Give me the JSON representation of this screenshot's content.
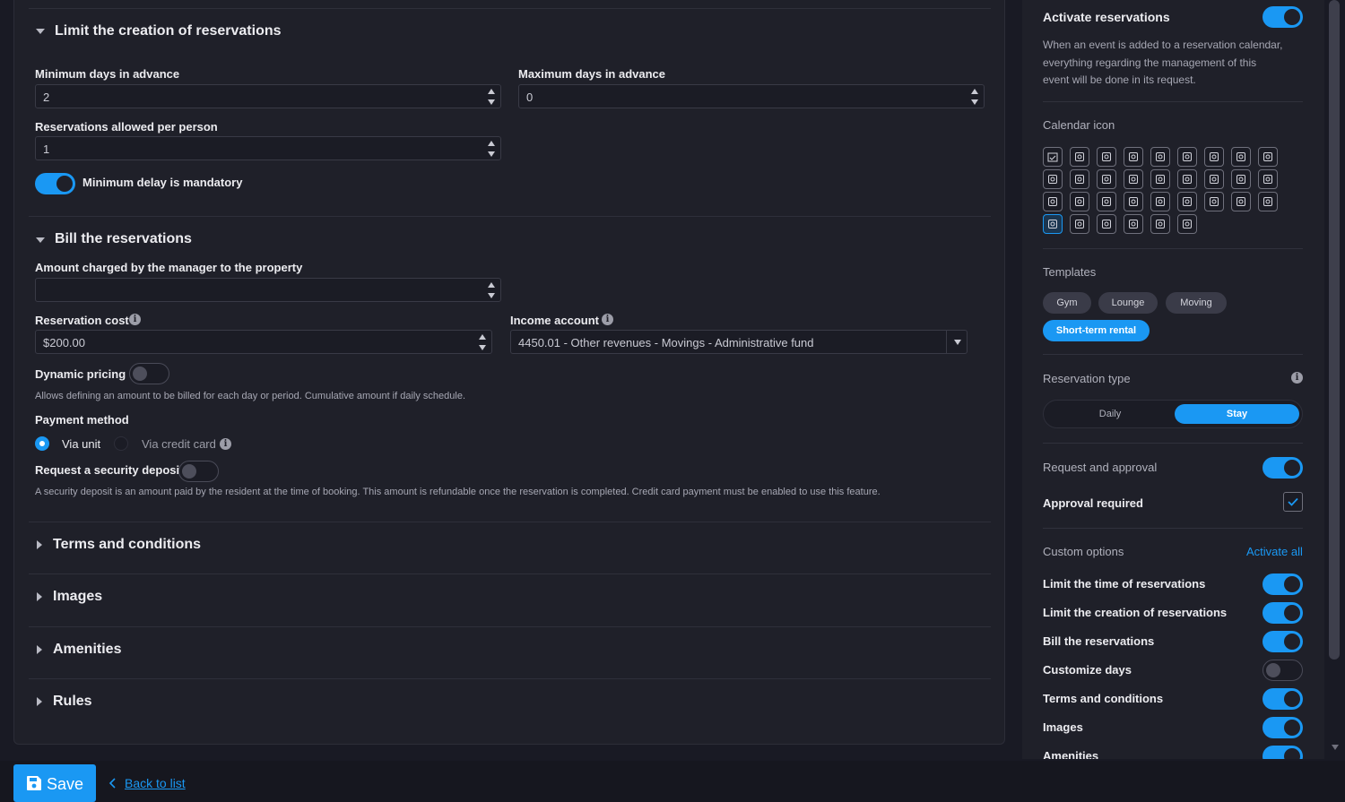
{
  "limit_creation": {
    "title": "Limit the creation of reservations",
    "min_days_label": "Minimum days in advance",
    "min_days_value": "2",
    "max_days_label": "Maximum days in advance",
    "max_days_value": "0",
    "per_person_label": "Reservations allowed per person",
    "per_person_value": "1",
    "min_delay_label": "Minimum delay is mandatory",
    "min_delay_on": true
  },
  "billing": {
    "title": "Bill the reservations",
    "amount_label": "Amount charged by the manager to the property",
    "amount_value": "",
    "cost_label": "Reservation cost",
    "cost_value": "$200.00",
    "income_label": "Income account",
    "income_value": "4450.01 - Other revenues - Movings - Administrative fund",
    "dynamic_label": "Dynamic pricing",
    "dynamic_on": false,
    "dynamic_help": "Allows defining an amount to be billed for each day or period. Cumulative amount if daily schedule.",
    "payment_label": "Payment method",
    "via_unit": "Via unit",
    "via_card": "Via credit card",
    "deposit_label": "Request a security deposit",
    "deposit_on": false,
    "deposit_help": "A security deposit is an amount paid by the resident at the time of booking. This amount is refundable once the reservation is completed. Credit card payment must be enabled to use this feature."
  },
  "collapsed_sections": [
    "Terms and conditions",
    "Images",
    "Amenities",
    "Rules"
  ],
  "side": {
    "activate_label": "Activate reservations",
    "activate_desc": [
      "When an event is added to a reservation calendar,",
      "everything regarding the management of this",
      "event will be done in its request."
    ],
    "calendar_icon_label": "Calendar icon",
    "icons": [
      "calendar-check-icon",
      "truck-icon",
      "family-icon",
      "group-icon",
      "concierge-icon",
      "tombstone-icon",
      "runner-icon",
      "pool-icon",
      "dumbbell-icon",
      "bicycle-icon",
      "box-icon",
      "gift-box-icon",
      "calendar-icon",
      "clipboard-icon",
      "flag-icon",
      "motorcycle-icon",
      "car-icon",
      "building-icon",
      "garage-icon",
      "bookshelf-icon",
      "sofa-icon",
      "binoculars-icon",
      "library-icon",
      "gamepad-icon",
      "locker-icon",
      "tags-icon",
      "house-icon",
      "bed-icon",
      "map-pin-icon",
      "pawn-icon",
      "parking-garage-icon",
      "cinema-icon",
      "barbecue-icon"
    ],
    "selected_icon_index": 27,
    "templates_label": "Templates",
    "templates": [
      "Gym",
      "Lounge",
      "Moving",
      "Short-term rental"
    ],
    "selected_template": "Short-term rental",
    "reservation_type_label": "Reservation type",
    "reservation_types": [
      "Daily",
      "Stay"
    ],
    "selected_reservation_type": "Stay",
    "request_approval_label": "Request and approval",
    "approval_required_label": "Approval required",
    "custom_options_label": "Custom options",
    "activate_all": "Activate all",
    "options": [
      {
        "label": "Limit the time of reservations",
        "on": true
      },
      {
        "label": "Limit the creation of reservations",
        "on": true
      },
      {
        "label": "Bill the reservations",
        "on": true
      },
      {
        "label": "Customize days",
        "on": false
      },
      {
        "label": "Terms and conditions",
        "on": true
      },
      {
        "label": "Images",
        "on": true
      },
      {
        "label": "Amenities",
        "on": true
      }
    ]
  },
  "footer": {
    "save_label": "Save",
    "back_label": "Back to list"
  },
  "colors": {
    "accent": "#1a98f3",
    "background": "#191a24",
    "card": "#1f2029"
  }
}
